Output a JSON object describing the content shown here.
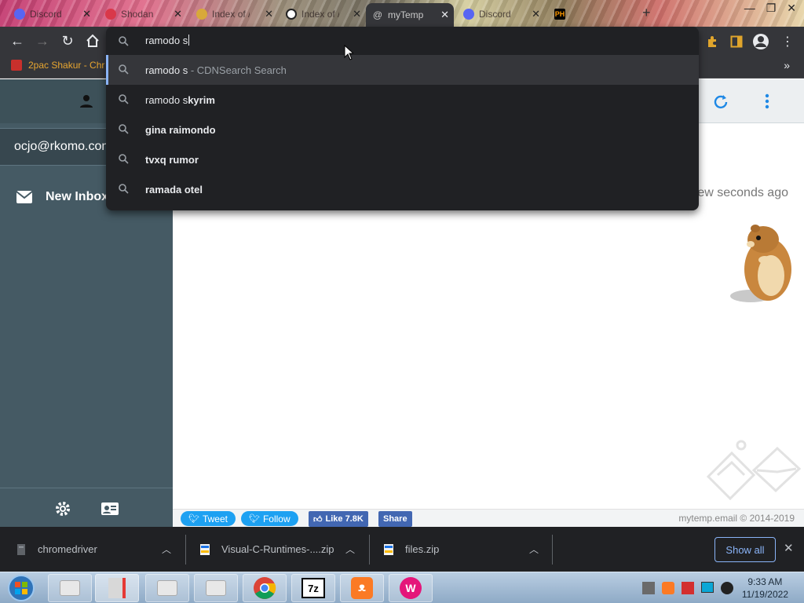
{
  "tabs": [
    {
      "label": "Discord",
      "icon": "discord-icon"
    },
    {
      "label": "Shodan",
      "icon": "shodan-icon"
    },
    {
      "label": "Index of /",
      "icon": "folder-icon"
    },
    {
      "label": "Index of /",
      "icon": "github-icon"
    },
    {
      "label": "myTemp",
      "icon": "at-sign-icon",
      "active": true
    },
    {
      "label": "Discord",
      "icon": "discord-icon"
    },
    {
      "label": "PH",
      "icon": "ph-icon"
    }
  ],
  "omnibox": {
    "query": "ramodo s",
    "suggestions": [
      {
        "typed": "ramodo s",
        "bold": "",
        "suffix": " - CDNSearch Search",
        "selected": true
      },
      {
        "typed": "ramodo s",
        "bold": "kyrim",
        "suffix": ""
      },
      {
        "typed": "",
        "bold": "gina raimondo",
        "suffix": ""
      },
      {
        "typed": "",
        "bold": "tvxq rumor",
        "suffix": ""
      },
      {
        "typed": "",
        "bold": "ramada otel",
        "suffix": ""
      }
    ]
  },
  "bookmarks": {
    "first": "2pac Shakur - Chr"
  },
  "sidebar": {
    "email": "ocjo@rkomo.com",
    "inbox_label": "New Inbox"
  },
  "main": {
    "time_ago": "ew seconds ago"
  },
  "footer": {
    "tweet": "Tweet",
    "follow": "Follow",
    "like": "Like 7.8K",
    "share": "Share",
    "copyright": "mytemp.email © 2014-2019"
  },
  "downloads": {
    "items": [
      "chromedriver",
      "Visual-C-Runtimes-....zip",
      "files.zip"
    ],
    "show_all": "Show all"
  },
  "taskbar": {
    "time": "9:33 AM",
    "date": "11/19/2022",
    "apps": [
      "7z"
    ]
  },
  "colors": {
    "accent": "#8ab4f8",
    "sidebar": "#455a64",
    "twitter": "#1da1f2",
    "facebook": "#4267b2"
  }
}
